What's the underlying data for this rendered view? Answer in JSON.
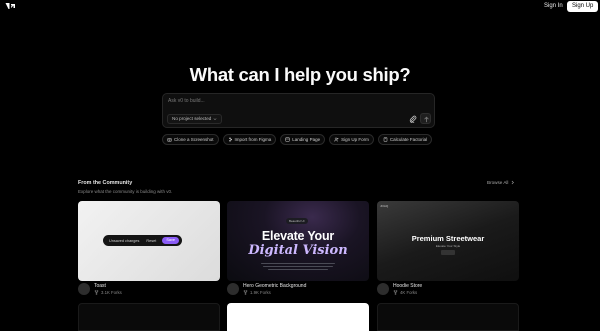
{
  "header": {
    "logo_icon": "v0-logo-icon",
    "sign_in_label": "Sign In",
    "sign_up_label": "Sign Up"
  },
  "hero": {
    "headline": "What can I help you ship?"
  },
  "prompt": {
    "placeholder": "Ask v0 to build...",
    "project_select": "No project selected",
    "attach_icon": "paperclip-icon",
    "send_icon": "arrow-up-icon"
  },
  "chips": [
    {
      "label": "Clone a Screenshot",
      "icon": "camera-icon"
    },
    {
      "label": "Import from Figma",
      "icon": "figma-icon"
    },
    {
      "label": "Landing Page",
      "icon": "layout-icon"
    },
    {
      "label": "Sign Up Form",
      "icon": "user-plus-icon"
    },
    {
      "label": "Calculate Factorial",
      "icon": "calculator-icon"
    }
  ],
  "community": {
    "title": "From the Community",
    "subtitle": "Explore what the community is building with v0.",
    "browse_label": "Browse All"
  },
  "cards": [
    {
      "name": "Toast",
      "forks": "3.1K Forks",
      "preview": {
        "text": "Unsaved changes",
        "reset": "Reset",
        "save": "Save"
      }
    },
    {
      "name": "Hero Geometric Background",
      "forks": "1.9K Forks",
      "preview": {
        "badge": "Beautiful UI",
        "line1": "Elevate Your",
        "line2": "Digital Vision"
      }
    },
    {
      "name": "Hoodie Store",
      "forks": "4K Forks",
      "preview": {
        "nav": "JOAQ",
        "title": "Premium Streetwear",
        "sub": "Elevate Your Style"
      }
    }
  ],
  "colors": {
    "background": "#000000",
    "accent": "#8b5cf6",
    "text": "#ededed"
  }
}
